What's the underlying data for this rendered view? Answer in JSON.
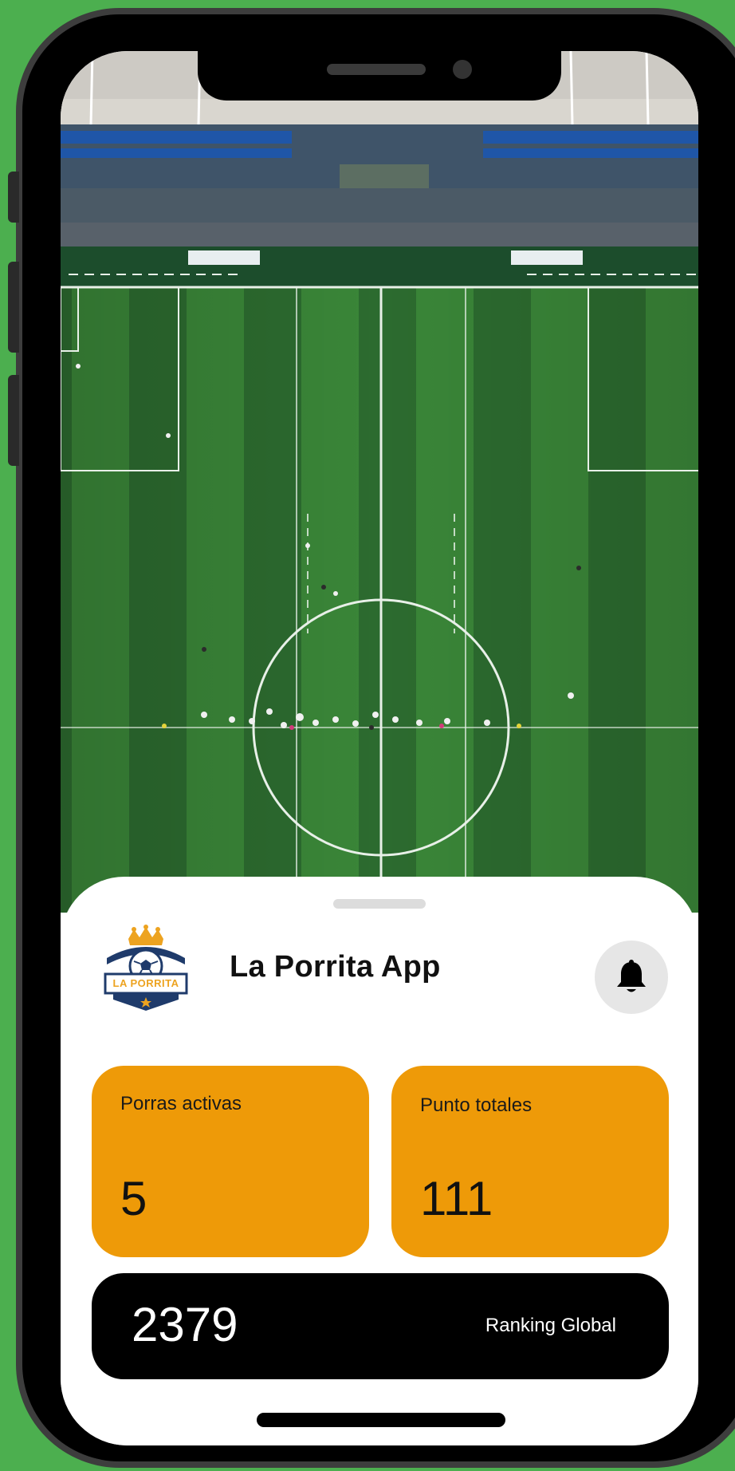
{
  "app": {
    "title": "La Porrita App",
    "logo_text": "LA PORRITA"
  },
  "stats": {
    "active_label": "Porras activas",
    "active_value": "5",
    "points_label": "Punto totales",
    "points_value": "111"
  },
  "ranking": {
    "value": "2379",
    "label": "Ranking Global"
  },
  "colors": {
    "accent": "#ee9a08",
    "background": "#4caf4f",
    "navy": "#1f3b6b"
  },
  "icons": {
    "notification": "bell-icon",
    "logo": "soccer-ball-crown-shield-icon"
  }
}
